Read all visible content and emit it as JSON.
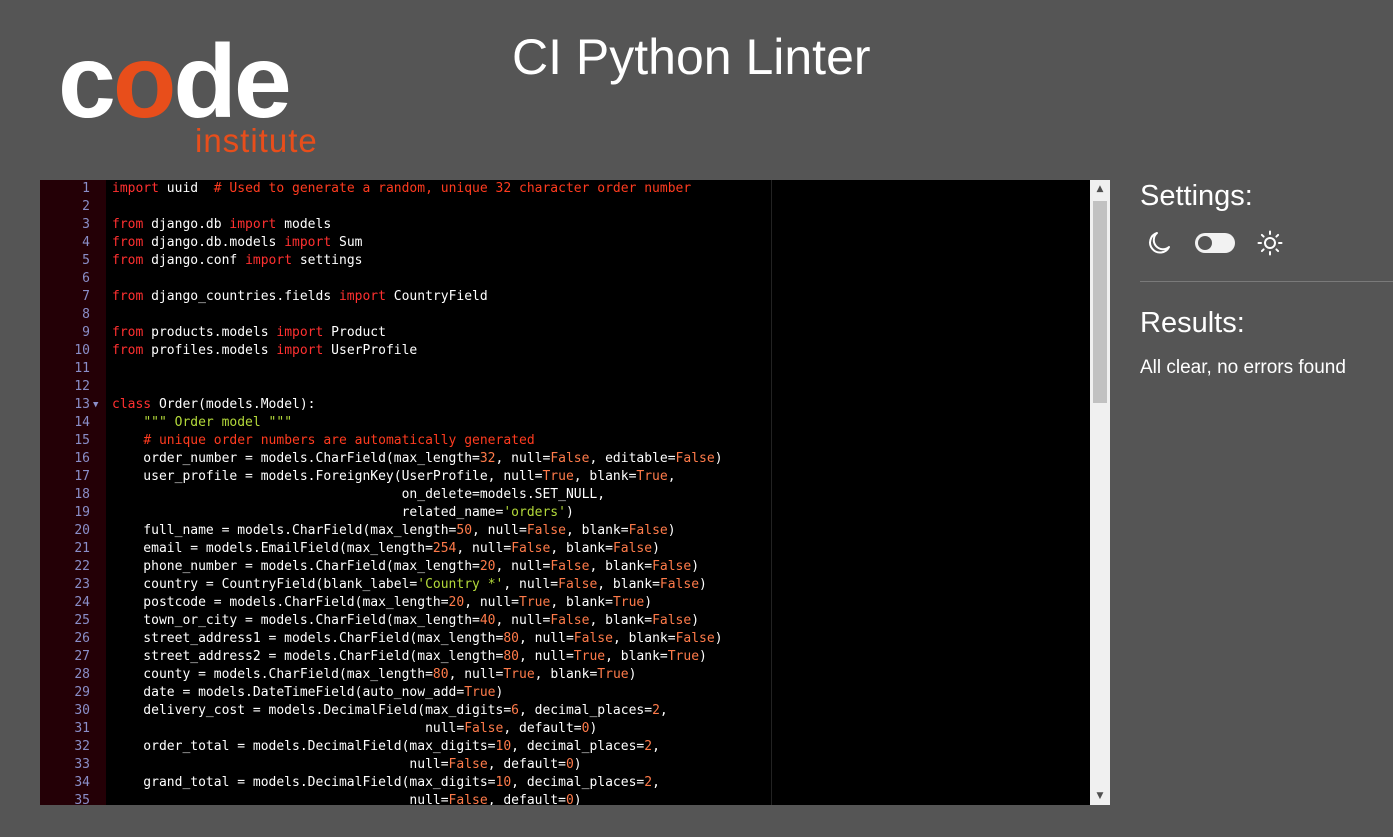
{
  "logo": {
    "word_prefix": "c",
    "word_o": "o",
    "word_suffix": "de",
    "sub": "institute"
  },
  "title": "CI Python Linter",
  "settings": {
    "heading": "Settings:",
    "icons": [
      "moon-icon",
      "toggle-switch",
      "sun-icon"
    ]
  },
  "results": {
    "heading": "Results:",
    "text": "All clear, no errors found"
  },
  "colors": {
    "background": "#555555",
    "accent": "#e84e1b",
    "editor_bg": "#000000",
    "gutter_bg": "#240006",
    "keyword": "#ff3030",
    "number": "#ff7b4a",
    "string": "#b3d93a"
  },
  "editor": {
    "lines": [
      [
        [
          "kw",
          "import"
        ],
        [
          "t",
          " uuid  "
        ],
        [
          "cm",
          "# Used to generate a random, unique 32 character order number"
        ]
      ],
      [],
      [
        [
          "kw",
          "from"
        ],
        [
          "t",
          " django.db "
        ],
        [
          "kw",
          "import"
        ],
        [
          "t",
          " models"
        ]
      ],
      [
        [
          "kw",
          "from"
        ],
        [
          "t",
          " django.db.models "
        ],
        [
          "kw",
          "import"
        ],
        [
          "t",
          " Sum"
        ]
      ],
      [
        [
          "kw",
          "from"
        ],
        [
          "t",
          " django.conf "
        ],
        [
          "kw",
          "import"
        ],
        [
          "t",
          " settings"
        ]
      ],
      [],
      [
        [
          "kw",
          "from"
        ],
        [
          "t",
          " django_countries.fields "
        ],
        [
          "kw",
          "import"
        ],
        [
          "t",
          " CountryField"
        ]
      ],
      [],
      [
        [
          "kw",
          "from"
        ],
        [
          "t",
          " products.models "
        ],
        [
          "kw",
          "import"
        ],
        [
          "t",
          " Product"
        ]
      ],
      [
        [
          "kw",
          "from"
        ],
        [
          "t",
          " profiles.models "
        ],
        [
          "kw",
          "import"
        ],
        [
          "t",
          " UserProfile"
        ]
      ],
      [],
      [],
      [
        [
          "kw",
          "class"
        ],
        [
          "t",
          " Order(models.Model):"
        ]
      ],
      [
        [
          "t",
          "    "
        ],
        [
          "str",
          "\"\"\" Order model \"\"\""
        ]
      ],
      [
        [
          "t",
          "    "
        ],
        [
          "cm",
          "# unique order numbers are automatically generated"
        ]
      ],
      [
        [
          "t",
          "    order_number = models.CharField(max_length="
        ],
        [
          "num",
          "32"
        ],
        [
          "t",
          ", null="
        ],
        [
          "num",
          "False"
        ],
        [
          "t",
          ", editable="
        ],
        [
          "num",
          "False"
        ],
        [
          "t",
          ")"
        ]
      ],
      [
        [
          "t",
          "    user_profile = models.ForeignKey(UserProfile, null="
        ],
        [
          "num",
          "True"
        ],
        [
          "t",
          ", blank="
        ],
        [
          "num",
          "True"
        ],
        [
          "t",
          ","
        ]
      ],
      [
        [
          "t",
          "                                     on_delete=models.SET_NULL,"
        ]
      ],
      [
        [
          "t",
          "                                     related_name="
        ],
        [
          "str",
          "'orders'"
        ],
        [
          "t",
          ")"
        ]
      ],
      [
        [
          "t",
          "    full_name = models.CharField(max_length="
        ],
        [
          "num",
          "50"
        ],
        [
          "t",
          ", null="
        ],
        [
          "num",
          "False"
        ],
        [
          "t",
          ", blank="
        ],
        [
          "num",
          "False"
        ],
        [
          "t",
          ")"
        ]
      ],
      [
        [
          "t",
          "    email = models.EmailField(max_length="
        ],
        [
          "num",
          "254"
        ],
        [
          "t",
          ", null="
        ],
        [
          "num",
          "False"
        ],
        [
          "t",
          ", blank="
        ],
        [
          "num",
          "False"
        ],
        [
          "t",
          ")"
        ]
      ],
      [
        [
          "t",
          "    phone_number = models.CharField(max_length="
        ],
        [
          "num",
          "20"
        ],
        [
          "t",
          ", null="
        ],
        [
          "num",
          "False"
        ],
        [
          "t",
          ", blank="
        ],
        [
          "num",
          "False"
        ],
        [
          "t",
          ")"
        ]
      ],
      [
        [
          "t",
          "    country = CountryField(blank_label="
        ],
        [
          "str",
          "'Country *'"
        ],
        [
          "t",
          ", null="
        ],
        [
          "num",
          "False"
        ],
        [
          "t",
          ", blank="
        ],
        [
          "num",
          "False"
        ],
        [
          "t",
          ")"
        ]
      ],
      [
        [
          "t",
          "    postcode = models.CharField(max_length="
        ],
        [
          "num",
          "20"
        ],
        [
          "t",
          ", null="
        ],
        [
          "num",
          "True"
        ],
        [
          "t",
          ", blank="
        ],
        [
          "num",
          "True"
        ],
        [
          "t",
          ")"
        ]
      ],
      [
        [
          "t",
          "    town_or_city = models.CharField(max_length="
        ],
        [
          "num",
          "40"
        ],
        [
          "t",
          ", null="
        ],
        [
          "num",
          "False"
        ],
        [
          "t",
          ", blank="
        ],
        [
          "num",
          "False"
        ],
        [
          "t",
          ")"
        ]
      ],
      [
        [
          "t",
          "    street_address1 = models.CharField(max_length="
        ],
        [
          "num",
          "80"
        ],
        [
          "t",
          ", null="
        ],
        [
          "num",
          "False"
        ],
        [
          "t",
          ", blank="
        ],
        [
          "num",
          "False"
        ],
        [
          "t",
          ")"
        ]
      ],
      [
        [
          "t",
          "    street_address2 = models.CharField(max_length="
        ],
        [
          "num",
          "80"
        ],
        [
          "t",
          ", null="
        ],
        [
          "num",
          "True"
        ],
        [
          "t",
          ", blank="
        ],
        [
          "num",
          "True"
        ],
        [
          "t",
          ")"
        ]
      ],
      [
        [
          "t",
          "    county = models.CharField(max_length="
        ],
        [
          "num",
          "80"
        ],
        [
          "t",
          ", null="
        ],
        [
          "num",
          "True"
        ],
        [
          "t",
          ", blank="
        ],
        [
          "num",
          "True"
        ],
        [
          "t",
          ")"
        ]
      ],
      [
        [
          "t",
          "    date = models.DateTimeField(auto_now_add="
        ],
        [
          "num",
          "True"
        ],
        [
          "t",
          ")"
        ]
      ],
      [
        [
          "t",
          "    delivery_cost = models.DecimalField(max_digits="
        ],
        [
          "num",
          "6"
        ],
        [
          "t",
          ", decimal_places="
        ],
        [
          "num",
          "2"
        ],
        [
          "t",
          ","
        ]
      ],
      [
        [
          "t",
          "                                        null="
        ],
        [
          "num",
          "False"
        ],
        [
          "t",
          ", default="
        ],
        [
          "num",
          "0"
        ],
        [
          "t",
          ")"
        ]
      ],
      [
        [
          "t",
          "    order_total = models.DecimalField(max_digits="
        ],
        [
          "num",
          "10"
        ],
        [
          "t",
          ", decimal_places="
        ],
        [
          "num",
          "2"
        ],
        [
          "t",
          ","
        ]
      ],
      [
        [
          "t",
          "                                      null="
        ],
        [
          "num",
          "False"
        ],
        [
          "t",
          ", default="
        ],
        [
          "num",
          "0"
        ],
        [
          "t",
          ")"
        ]
      ],
      [
        [
          "t",
          "    grand_total = models.DecimalField(max_digits="
        ],
        [
          "num",
          "10"
        ],
        [
          "t",
          ", decimal_places="
        ],
        [
          "num",
          "2"
        ],
        [
          "t",
          ","
        ]
      ],
      [
        [
          "t",
          "                                      null="
        ],
        [
          "num",
          "False"
        ],
        [
          "t",
          ", default="
        ],
        [
          "num",
          "0"
        ],
        [
          "t",
          ")"
        ]
      ]
    ],
    "fold_lines": [
      13
    ]
  }
}
